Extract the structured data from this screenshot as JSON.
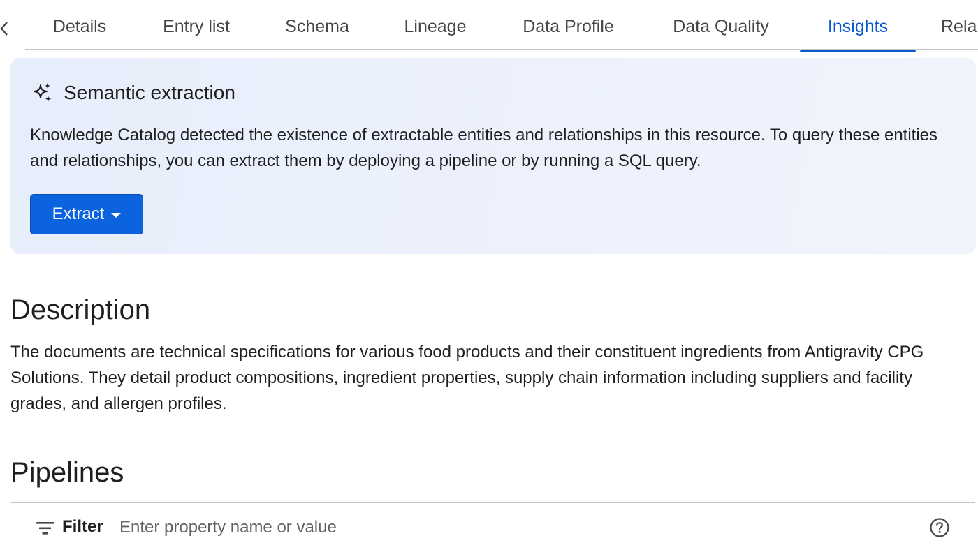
{
  "tabs": {
    "items": [
      {
        "label": "Details"
      },
      {
        "label": "Entry list"
      },
      {
        "label": "Schema"
      },
      {
        "label": "Lineage"
      },
      {
        "label": "Data Profile"
      },
      {
        "label": "Data Quality"
      },
      {
        "label": "Insights",
        "active": true
      },
      {
        "label": "Rela"
      }
    ]
  },
  "semantic_card": {
    "icon": "sparkle-icon",
    "title": "Semantic extraction",
    "body": "Knowledge Catalog detected the existence of extractable entities and relationships in this resource. To query these entities and relationships, you can extract them by deploying a pipeline or by running a SQL query.",
    "extract_label": "Extract"
  },
  "description": {
    "heading": "Description",
    "body": "The documents are technical specifications for various food products and their constituent ingredients from Antigravity CPG Solutions. They detail product compositions, ingredient properties, supply chain information including suppliers and facility grades, and allergen profiles."
  },
  "pipelines": {
    "heading": "Pipelines",
    "filter": {
      "label": "Filter",
      "placeholder": "Enter property name or value",
      "value": ""
    }
  },
  "colors": {
    "accent": "#0b57d0",
    "button": "#0b63dd",
    "card_bg": "#e7eefb",
    "text": "#1f1f1f",
    "muted": "#444746"
  }
}
